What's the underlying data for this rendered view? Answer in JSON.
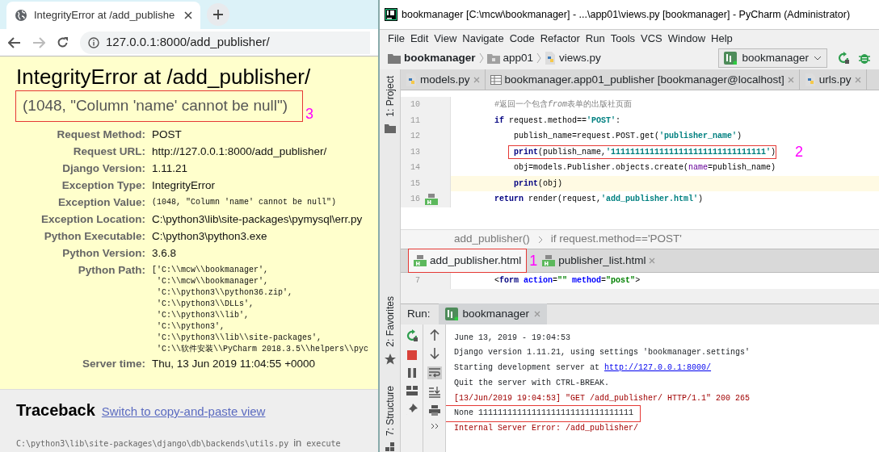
{
  "browser": {
    "tab": {
      "title": "IntegrityError at /add_publishe",
      "selected": true
    },
    "address": "127.0.0.1:8000/add_publisher/",
    "page": {
      "title": "IntegrityError at /add_publisher/",
      "summary": "(1048, \"Column 'name' cannot be null\")",
      "summary_boxed": true,
      "summary_annotation": "3",
      "meta": [
        {
          "label": "Request Method:",
          "kind": "text",
          "value": "POST"
        },
        {
          "label": "Request URL:",
          "kind": "text",
          "value": "http://127.0.0.1:8000/add_publisher/"
        },
        {
          "label": "Django Version:",
          "kind": "text",
          "value": "1.11.21"
        },
        {
          "label": "Exception Type:",
          "kind": "text",
          "value": "IntegrityError"
        },
        {
          "label": "Exception Value:",
          "kind": "mono",
          "value": "(1048, \"Column 'name' cannot be null\")"
        },
        {
          "label": "Exception Location:",
          "kind": "text",
          "value": "C:\\python3\\lib\\site-packages\\pymysql\\err.py"
        },
        {
          "label": "Python Executable:",
          "kind": "text",
          "value": "C:\\python3\\python3.exe"
        },
        {
          "label": "Python Version:",
          "kind": "text",
          "value": "3.6.8"
        },
        {
          "label": "Python Path:",
          "kind": "list",
          "lines": [
            "['C:\\\\mcw\\\\bookmanager',",
            " 'C:\\\\mcw\\\\bookmanager',",
            " 'C:\\\\python3\\\\python36.zip',",
            " 'C:\\\\python3\\\\DLLs',",
            " 'C:\\\\python3\\\\lib',",
            " 'C:\\\\python3',",
            " 'C:\\\\python3\\\\lib\\\\site-packages',",
            " 'C:\\\\软件安装\\\\PyCharm 2018.3.5\\\\helpers\\\\pyc"
          ]
        },
        {
          "label": "Server time:",
          "kind": "text",
          "value": "Thu, 13 Jun 2019 11:04:55 +0000"
        }
      ],
      "traceback": {
        "heading": "Traceback",
        "link": "Switch to copy-and-paste view",
        "frame_path": "C:\\python3\\lib\\site-packages\\django\\db\\backends\\utils.py",
        "frame_in": "in",
        "frame_func": "execute"
      }
    }
  },
  "ide": {
    "title": "bookmanager [C:\\mcw\\bookmanager] - ...\\app01\\views.py [bookmanager] - PyCharm (Administrator)",
    "menu": [
      "File",
      "Edit",
      "View",
      "Navigate",
      "Code",
      "Refactor",
      "Run",
      "Tools",
      "VCS",
      "Window",
      "Help"
    ],
    "path": [
      {
        "label": "bookmanager",
        "kind": "project"
      },
      {
        "label": "app01",
        "kind": "folder"
      },
      {
        "label": "views.py",
        "kind": "python"
      }
    ],
    "run_config": "bookmanager",
    "side_tools": [
      "1: Project",
      "2: Favorites",
      "7: Structure"
    ],
    "editor_tabs": [
      {
        "label": "models.py",
        "kind": "python",
        "selected": false
      },
      {
        "label": "bookmanager.app01_publisher [bookmanager@localhost]",
        "kind": "table",
        "selected": false
      },
      {
        "label": "urls.py",
        "kind": "python",
        "selected": false
      }
    ],
    "code": [
      {
        "number": "10",
        "current": false,
        "boxed": false,
        "kind": "outer",
        "tokens": [
          {
            "kind": "comment",
            "text": "#返回一个包含"
          },
          {
            "kind": "emphasis",
            "text": "from"
          },
          {
            "kind": "comment",
            "text": "表单的出版社页面"
          }
        ]
      },
      {
        "number": "11",
        "current": false,
        "boxed": false,
        "kind": "outer",
        "tokens": [
          {
            "kind": "keyword",
            "text": "if"
          },
          {
            "kind": "plain",
            "text": " request.method=="
          },
          {
            "kind": "string",
            "text": "'POST'"
          },
          {
            "kind": "plain",
            "text": ":"
          }
        ]
      },
      {
        "number": "12",
        "current": false,
        "boxed": false,
        "kind": "inner",
        "tokens": [
          {
            "kind": "plain",
            "text": "publish_name=request.POST.get("
          },
          {
            "kind": "string",
            "text": "'publisher_name'"
          },
          {
            "kind": "plain",
            "text": ")"
          }
        ]
      },
      {
        "number": "13",
        "current": false,
        "boxed": true,
        "annotation": "2",
        "kind": "inner",
        "tokens": [
          {
            "kind": "builtin",
            "text": "print"
          },
          {
            "kind": "plain",
            "text": "(publish_name,"
          },
          {
            "kind": "string",
            "text": "'11111111111111111111111111111111'"
          },
          {
            "kind": "plain",
            "text": ")"
          }
        ]
      },
      {
        "number": "14",
        "current": false,
        "boxed": false,
        "kind": "inner",
        "tokens": [
          {
            "kind": "plain",
            "text": "obj=models.Publisher.objects.create("
          },
          {
            "kind": "param",
            "text": "name"
          },
          {
            "kind": "plain",
            "text": "=publish_name)"
          }
        ]
      },
      {
        "number": "15",
        "current": true,
        "boxed": false,
        "kind": "inner",
        "tokens": [
          {
            "kind": "builtin",
            "text": "print"
          },
          {
            "kind": "plain",
            "text": "(obj)"
          }
        ]
      },
      {
        "number": "16",
        "current": false,
        "boxed": false,
        "kind": "outer",
        "tokens": [
          {
            "kind": "keyword",
            "text": "return"
          },
          {
            "kind": "plain",
            "text": " render(request,"
          },
          {
            "kind": "string",
            "text": "'add_publisher.html'"
          },
          {
            "kind": "plain",
            "text": ")"
          }
        ]
      }
    ],
    "breadcrumb": [
      "add_publisher()",
      "if request.method=='POST'"
    ],
    "bottom_tabs": [
      {
        "label": "add_publisher.html",
        "selected": true,
        "boxed": true,
        "annotation": "1"
      },
      {
        "label": "publisher_list.html",
        "selected": false,
        "boxed": false
      }
    ],
    "html_line": {
      "number": "7",
      "kind": "outer",
      "tokens": [
        {
          "kind": "plain",
          "text": "<"
        },
        {
          "kind": "tag",
          "text": "form"
        },
        {
          "kind": "attr",
          "text": " action"
        },
        {
          "kind": "plain",
          "text": "="
        },
        {
          "kind": "value",
          "text": "\"\""
        },
        {
          "kind": "attr",
          "text": " method"
        },
        {
          "kind": "plain",
          "text": "="
        },
        {
          "kind": "value",
          "text": "\"post\""
        },
        {
          "kind": "plain",
          "text": ">"
        }
      ]
    },
    "run": {
      "label": "Run:",
      "tab": "bookmanager",
      "lines": [
        {
          "kind": "normal",
          "boxed": false,
          "parts": [
            {
              "text": "June 13, 2019 - 19:04:53",
              "link": false
            }
          ]
        },
        {
          "kind": "normal",
          "boxed": false,
          "parts": [
            {
              "text": "Django version 1.11.21, using settings 'bookmanager.settings'",
              "link": false
            }
          ]
        },
        {
          "kind": "normal",
          "boxed": false,
          "parts": [
            {
              "text": "Starting development server at ",
              "link": false
            },
            {
              "text": "http://127.0.0.1:8000/",
              "link": true
            }
          ]
        },
        {
          "kind": "normal",
          "boxed": false,
          "parts": [
            {
              "text": "Quit the server with CTRL-BREAK.",
              "link": false
            }
          ]
        },
        {
          "kind": "error",
          "boxed": false,
          "parts": [
            {
              "text": "[13/Jun/2019 19:04:53] \"GET /add_publisher/ HTTP/1.1\" 200 265",
              "link": false
            }
          ]
        },
        {
          "kind": "normal",
          "boxed": true,
          "parts": [
            {
              "text": "None 11111111111111111111111111111111",
              "link": false
            }
          ]
        },
        {
          "kind": "error",
          "boxed": false,
          "parts": [
            {
              "text": "Internal Server Error: /add_publisher/",
              "link": false
            }
          ]
        }
      ]
    }
  }
}
